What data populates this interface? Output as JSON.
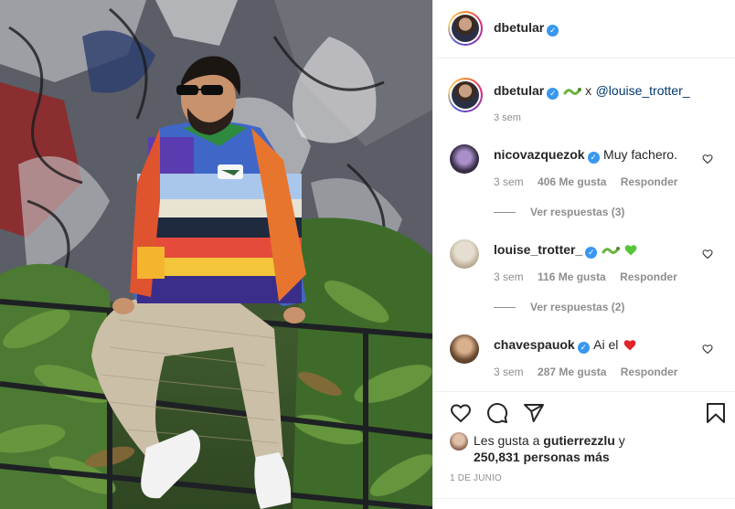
{
  "post": {
    "author": "dbetular",
    "verified_glyph": "✓",
    "caption_separator": "x",
    "caption_mention": "@louise_trotter_",
    "caption_time": "3 sem",
    "caption_icon": "snake-emoji"
  },
  "comments": [
    {
      "username": "nicovazquezok",
      "text": "Muy fachero.",
      "time": "3 sem",
      "likes": "406 Me gusta",
      "reply_label": "Responder",
      "view_replies": "Ver respuestas (3)"
    },
    {
      "username": "louise_trotter_",
      "text": "",
      "emojis": [
        "snake-emoji",
        "green-heart-emoji"
      ],
      "time": "3 sem",
      "likes": "116 Me gusta",
      "reply_label": "Responder",
      "view_replies": "Ver respuestas (2)"
    },
    {
      "username": "chavespauok",
      "text": "Ai el",
      "emojis": [
        "red-heart-emoji"
      ],
      "time": "3 sem",
      "likes": "287 Me gusta",
      "reply_label": "Responder"
    }
  ],
  "likes": {
    "prefix": "Les gusta a",
    "first_user": "gutierrezzlu",
    "connector": "y",
    "others_count": "250,831",
    "others_suffix": "personas más"
  },
  "date": "1 DE JUNIO",
  "icons": [
    "heart-icon",
    "comment-icon",
    "share-icon",
    "bookmark-icon"
  ],
  "colors": {
    "verified": "#3897f0",
    "mention": "#00376b",
    "muted": "#8e8e8e",
    "text": "#262626"
  }
}
